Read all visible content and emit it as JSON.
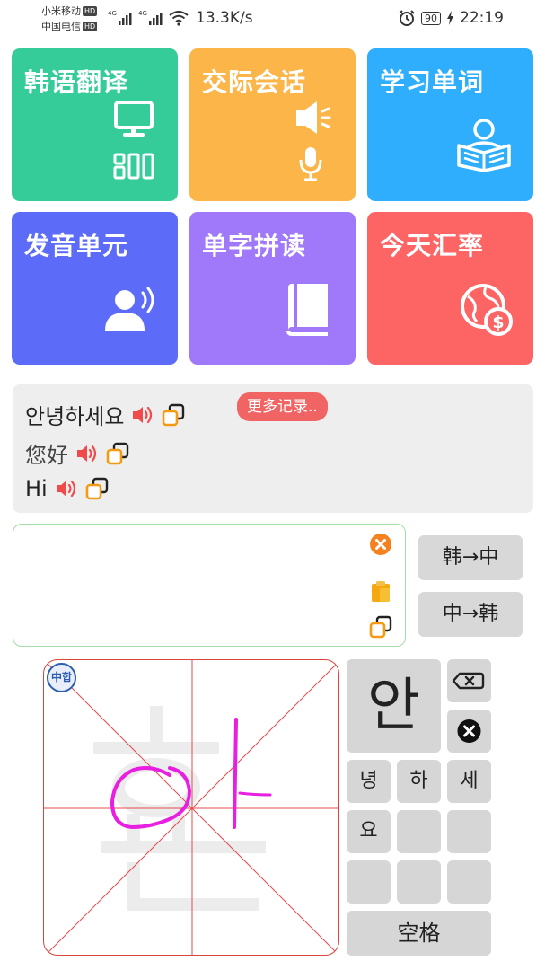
{
  "status_bar": {
    "carrier1": "小米移动",
    "carrier2": "中国电信",
    "hd": "HD",
    "net": "4G",
    "speed": "13.3K/s",
    "battery": "90",
    "time": "22:19"
  },
  "tiles": [
    {
      "title": "韩语翻译",
      "color": "#35cc9a",
      "icon": "monitor-qr-icon"
    },
    {
      "title": "交际会话",
      "color": "#fbb548",
      "icon": "speaker-mic-icon"
    },
    {
      "title": "学习单词",
      "color": "#2eaefc",
      "icon": "reading-person-icon"
    },
    {
      "title": "发音单元",
      "color": "#5d6cf8",
      "icon": "speaking-person-icon"
    },
    {
      "title": "单字拼读",
      "color": "#a079fa",
      "icon": "book-icon"
    },
    {
      "title": "今天汇率",
      "color": "#fd6464",
      "icon": "globe-dollar-icon"
    }
  ],
  "history": {
    "rows": [
      {
        "text": "안녕하세요"
      },
      {
        "text": "您好"
      },
      {
        "text": "Hi"
      }
    ],
    "more_button": "更多记录.."
  },
  "input": {
    "value": "",
    "buttons": [
      "韩→中",
      "中→韩"
    ]
  },
  "keyboard": {
    "badge": "中합",
    "big_candidate": "안",
    "candidates": [
      "녕",
      "하",
      "세",
      "요",
      "",
      "",
      "",
      "",
      ""
    ],
    "space_label": "空格"
  },
  "colors": {
    "speaker": "#f04a4a",
    "copy": "#f59a12",
    "clear": "#f5811f",
    "pad_border": "#d9443c",
    "stroke": "#e81ee0"
  }
}
